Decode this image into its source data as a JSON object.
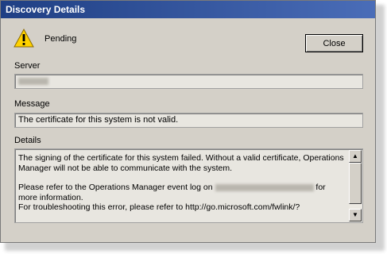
{
  "window": {
    "title": "Discovery Details"
  },
  "status": {
    "icon": "warning-icon",
    "text": "Pending"
  },
  "buttons": {
    "close_label": "Close"
  },
  "server": {
    "label": "Server",
    "value": ""
  },
  "message": {
    "label": "Message",
    "value": "The certificate for this system is not valid."
  },
  "details": {
    "label": "Details",
    "line1": "The signing of the certificate for this system failed. Without a valid certificate, Operations Manager will not be able to communicate with the system.",
    "line2_pre": "Please refer to the Operations Manager event log on",
    "line2_post": "for more information.",
    "line3": "For troubleshooting this error, please refer to http://go.microsoft.com/fwlink/?"
  },
  "scrollbar": {
    "up_icon": "arrow-up-icon",
    "down_icon": "arrow-down-icon"
  },
  "colors": {
    "titlebar": "#2f4d8e",
    "window_bg": "#d4d0c8",
    "warning": "#ffd200"
  }
}
